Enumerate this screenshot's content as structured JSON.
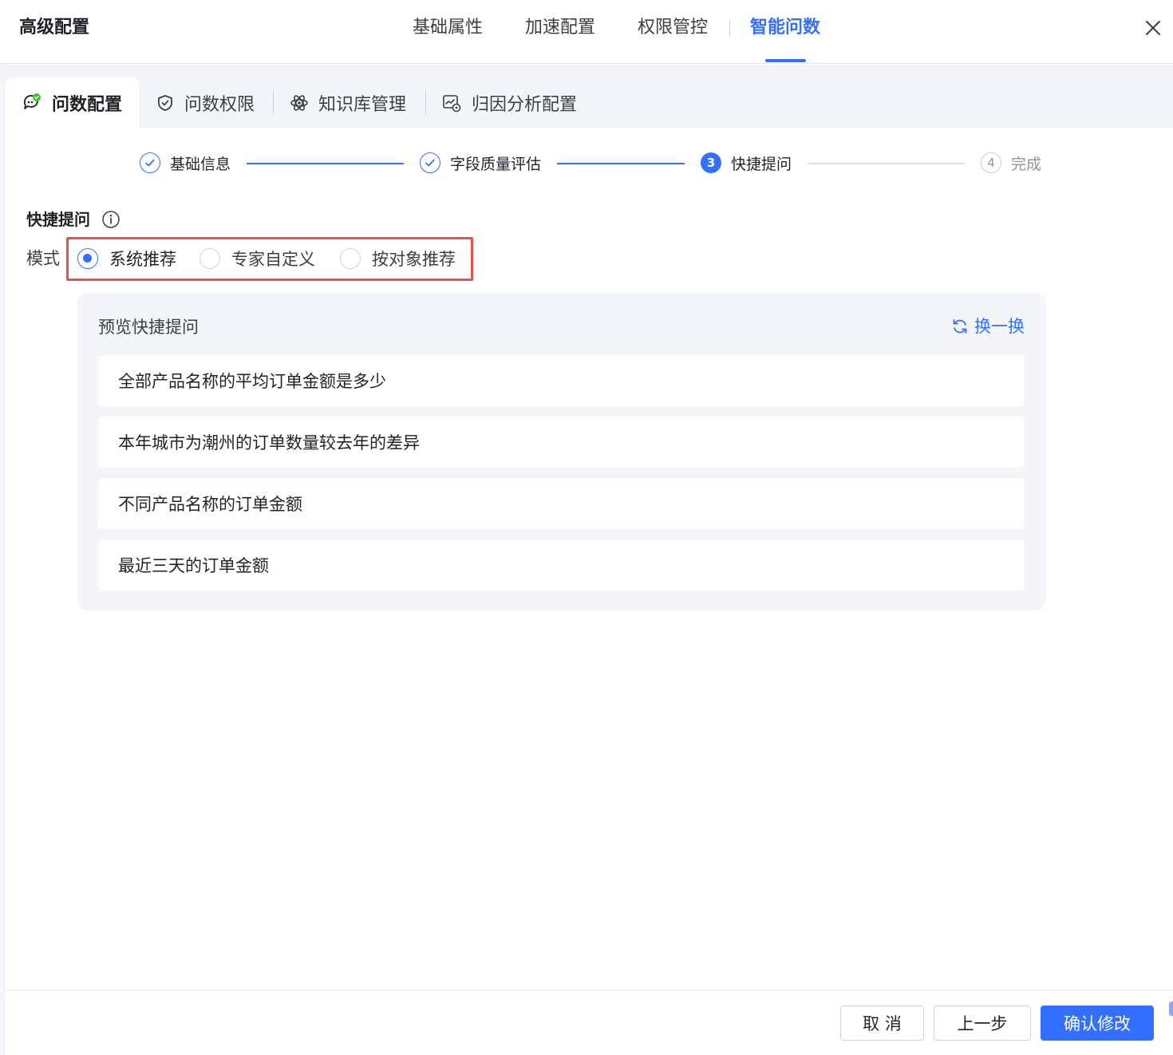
{
  "header": {
    "title": "高级配置",
    "tabs": [
      {
        "label": "基础属性"
      },
      {
        "label": "加速配置"
      },
      {
        "label": "权限管控"
      },
      {
        "label": "智能问数"
      }
    ],
    "active_tab": "智能问数",
    "close_icon": "close-icon"
  },
  "subtabs": [
    {
      "label": "问数配置",
      "icon": "chat-config-icon"
    },
    {
      "label": "问数权限",
      "icon": "shield-check-icon"
    },
    {
      "label": "知识库管理",
      "icon": "atom-icon"
    },
    {
      "label": "归因分析配置",
      "icon": "analysis-config-icon"
    }
  ],
  "steps": [
    {
      "label": "基础信息",
      "state": "done"
    },
    {
      "label": "字段质量评估",
      "state": "done"
    },
    {
      "label": "快捷提问",
      "state": "current",
      "number": "3"
    },
    {
      "label": "完成",
      "state": "todo",
      "number": "4"
    }
  ],
  "section": {
    "title": "快捷提问",
    "mode_label": "模式",
    "modes": [
      {
        "label": "系统推荐",
        "checked": true
      },
      {
        "label": "专家自定义",
        "checked": false
      },
      {
        "label": "按对象推荐",
        "checked": false
      }
    ]
  },
  "preview": {
    "title": "预览快捷提问",
    "refresh_label": "换一换",
    "questions": [
      "全部产品名称的平均订单金额是多少",
      "本年城市为潮州的订单数量较去年的差异",
      "不同产品名称的订单金额",
      "最近三天的订单金额"
    ]
  },
  "footer": {
    "cancel_label": "取 消",
    "prev_label": "上一步",
    "confirm_label": "确认修改"
  },
  "colors": {
    "accent": "#3370ff",
    "highlight_border": "#e8514a",
    "panel_bg": "#f3f5f9",
    "badge_green": "#34c724"
  }
}
